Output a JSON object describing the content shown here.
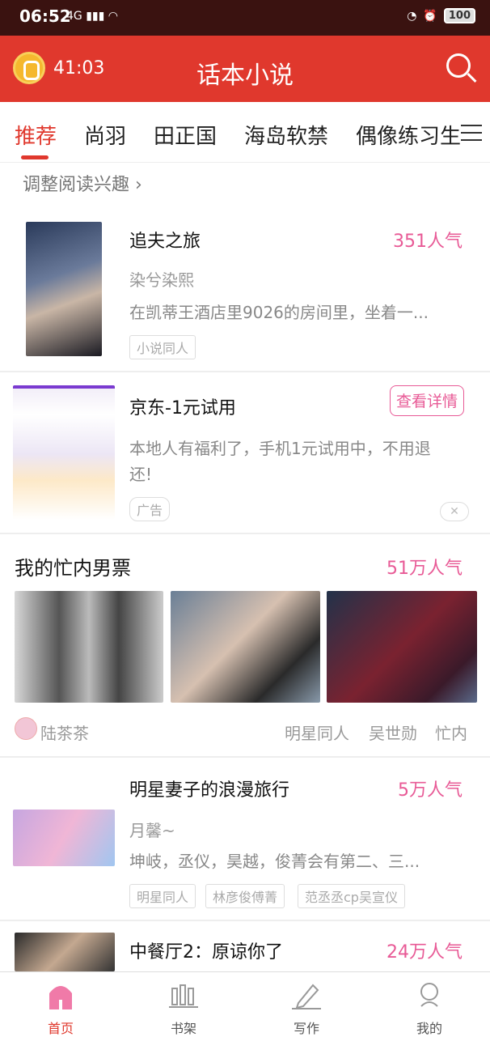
{
  "status": {
    "time": "06:52",
    "network": "4G",
    "battery": "100"
  },
  "header": {
    "timer": "41:03",
    "title": "话本小说"
  },
  "tabs": [
    "推荐",
    "尚羽",
    "田正国",
    "海岛软禁",
    "偶像练习生"
  ],
  "interest_link": "调整阅读兴趣",
  "feed": {
    "item1": {
      "title": "追夫之旅",
      "popularity": "351人气",
      "author": "染兮染熙",
      "excerpt": "在凯蒂王酒店里9026的房间里，坐着一...",
      "tags": [
        "小说同人"
      ]
    },
    "ad": {
      "title": "京东-1元试用",
      "button": "查看详情",
      "text_line1": "本地人有福利了，手机1元试用中，不用退",
      "text_line2": "还!",
      "tag": "广告",
      "close": "✕"
    },
    "item2": {
      "title": "我的忙内男票",
      "popularity": "51万人气",
      "author": "陆茶茶",
      "tags": [
        "明星同人",
        "吴世勋",
        "忙内"
      ]
    },
    "item3": {
      "title": "明星妻子的浪漫旅行",
      "popularity": "5万人气",
      "author": "月馨~",
      "excerpt": "坤岐，丞仪，昊越，俊菁会有第二、三...",
      "tags": [
        "明星同人",
        "林彦俊傅菁",
        "范丞丞cp吴宣仪"
      ]
    },
    "item4": {
      "title": "中餐厅2：原谅你了",
      "popularity": "24万人气"
    }
  },
  "bottom_nav": [
    "首页",
    "书架",
    "写作",
    "我的"
  ],
  "colors": {
    "primary": "#e0382d",
    "accent": "#e85a96"
  }
}
